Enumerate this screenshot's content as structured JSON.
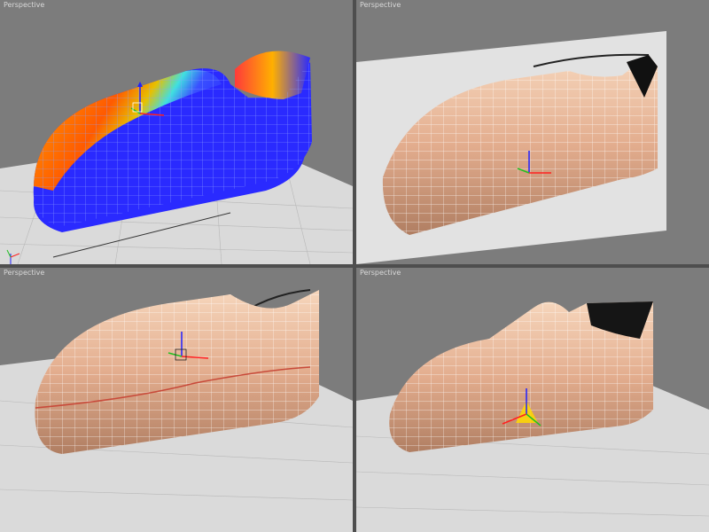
{
  "viewports": [
    {
      "label": "Perspective"
    },
    {
      "label": "Perspective"
    },
    {
      "label": "Perspective"
    },
    {
      "label": "Perspective"
    }
  ],
  "colors": {
    "viewport_bg": "#7c7c7c",
    "ground_grid": "#d6d6d6",
    "skin": "#e8b898",
    "wire": "#ffffff",
    "heat_blue": "#2a2aff",
    "heat_orange": "#ff6a00",
    "gizmo_x": "#ff2020",
    "gizmo_y": "#20c020",
    "gizmo_z": "#2020ff"
  },
  "icons": [
    "axis-tripod-icon",
    "transform-gizmo-icon"
  ]
}
